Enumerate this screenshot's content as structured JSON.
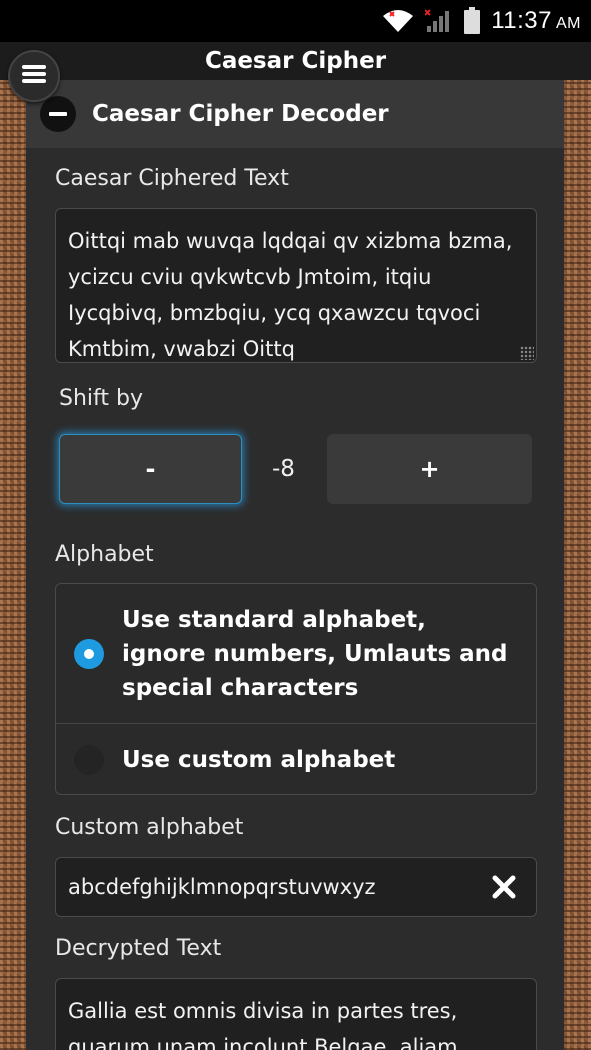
{
  "status_bar": {
    "time": "11:37",
    "ampm": "AM"
  },
  "header": {
    "title": "Caesar Cipher"
  },
  "panel": {
    "title": "Caesar Cipher Decoder"
  },
  "ciphered": {
    "label": "Caesar Ciphered Text",
    "value": "Oittqi mab wuvqa lqdqai qv xizbma bzma, ycizcu cviu qvkwtcvb Jmtoim, itqiu Iycqbivq, bmzbqiu, ycq qxawzcu tqvoci Kmtbim, vwabzi Oittq"
  },
  "shift": {
    "label": "Shift by",
    "minus_label": "-",
    "plus_label": "+",
    "value": "-8"
  },
  "alphabet": {
    "label": "Alphabet",
    "options": [
      {
        "label": "Use standard alphabet, ignore numbers, Umlauts and special characters",
        "selected": true
      },
      {
        "label": "Use custom alphabet",
        "selected": false
      }
    ]
  },
  "custom_alphabet": {
    "label": "Custom alphabet",
    "value": "abcdefghijklmnopqrstuvwxyz"
  },
  "decrypted": {
    "label": "Decrypted Text",
    "value": "Gallia est omnis divisa in partes tres, quarum unam incolunt Belgae, aliam"
  },
  "colors": {
    "accent": "#1e9be0",
    "panel_bg": "#2c2c2c",
    "header_bg": "#1c1c1c"
  }
}
